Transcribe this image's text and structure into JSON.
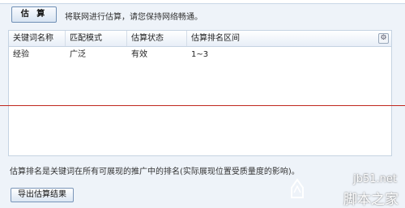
{
  "toolbar": {
    "estimate_label": "估 算",
    "hint": "将联网进行估算，请您保持网络畅通。"
  },
  "table": {
    "headers": [
      "关键词名称",
      "匹配模式",
      "估算状态",
      "估算排名区间"
    ],
    "rows": [
      [
        "经验",
        "广泛",
        "有效",
        "1~3"
      ]
    ],
    "options_icon": "gear-icon"
  },
  "footer": {
    "note": "估算排名是关键词在所有可展现的推广中的排名(实际展现位置受质量度的影响)。",
    "export_label": "导出估算结果"
  },
  "watermark": {
    "site": "jb51.net",
    "text": "脚本之家"
  },
  "colors": {
    "accent_line": "#c0271e",
    "panel_bg": "#eef3f9"
  }
}
